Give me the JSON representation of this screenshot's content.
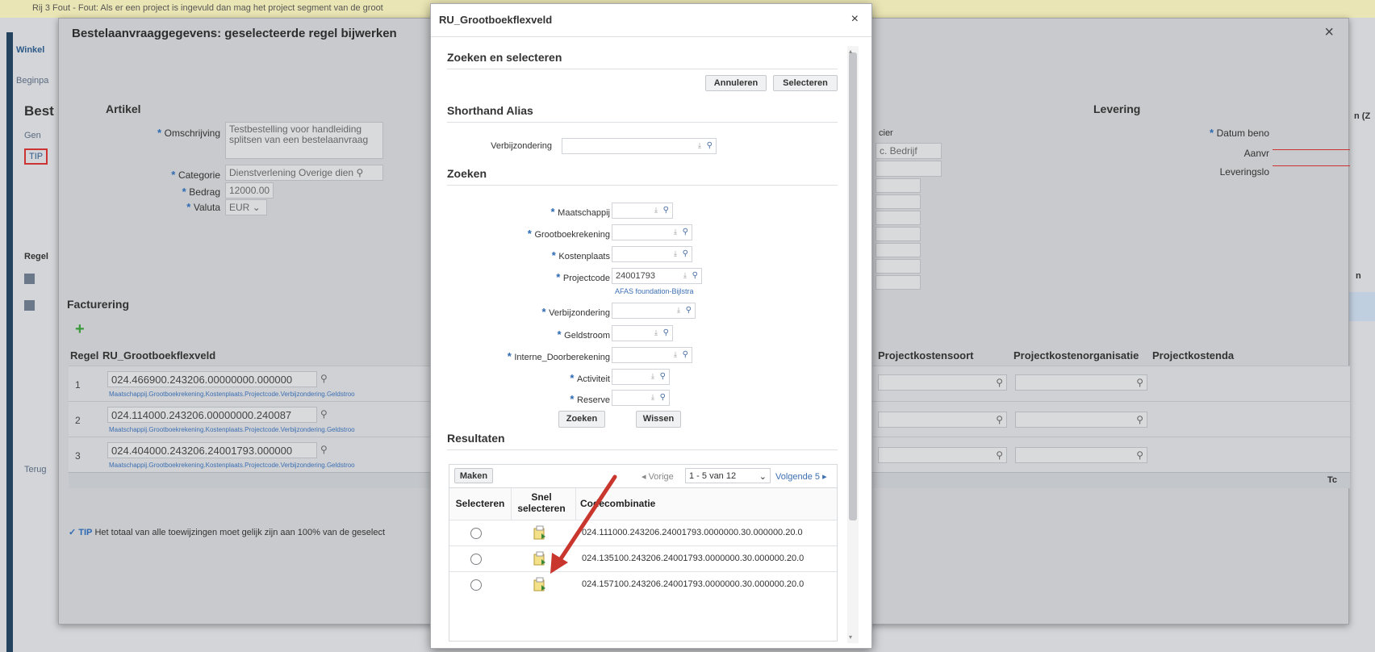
{
  "error_bar": "Rij 3 Fout - Fout: Als er een project is ingevuld dan mag het project segment van de groot",
  "background": {
    "tab": "Winkel",
    "breadcrumb": "Beginpa",
    "title": "Best",
    "gen": "Gen",
    "tip": "TIP",
    "regel": "Regel",
    "terug": "Terug",
    "right_label": "n (Z",
    "right_n": "n",
    "right_t": "Tc"
  },
  "main_dialog": {
    "title": "Bestelaanvraaggegevens: geselecteerde regel bijwerken",
    "close": "×",
    "artikel": {
      "heading": "Artikel",
      "omschrijving_label": "Omschrijving",
      "omschrijving_value": "Testbestelling voor handleiding splitsen van een bestelaanvraag",
      "categorie_label": "Categorie",
      "categorie_value": "Dienstverlening Overige dien",
      "bedrag_label": "Bedrag",
      "bedrag_value": "12000.00",
      "valuta_label": "Valuta",
      "valuta_value": "EUR"
    },
    "levering": {
      "heading": "Levering",
      "datum_label": "Datum beno",
      "aanvr_label": "Aanvr",
      "leveringslo_label": "Leveringslo",
      "cier_label": "cier",
      "bedrijf_value": "c. Bedrijf"
    },
    "facturering": {
      "heading": "Facturering",
      "add_icon": "plus-icon",
      "col_regel": "Regel",
      "col_ru": "RU_Grootboekflexveld",
      "col_projectkostensoort": "Projectkostensoort",
      "col_projectkostenorganisatie": "Projectkostenorganisatie",
      "col_projectkostenda": "Projectkostenda",
      "rows": [
        {
          "num": "1",
          "account": "024.466900.243206.00000000.000000",
          "segments": "Maatschappij.Grootboekrekening.Kostenplaats.Projectcode.Verbijzondering.Geldstroo"
        },
        {
          "num": "2",
          "account": "024.114000.243206.00000000.240087",
          "segments": "Maatschappij.Grootboekrekening.Kostenplaats.Projectcode.Verbijzondering.Geldstroo"
        },
        {
          "num": "3",
          "account": "024.404000.243206.24001793.000000",
          "segments": "Maatschappij.Grootboekrekening.Kostenplaats.Projectcode.Verbijzondering.Geldstroo"
        }
      ]
    },
    "tip_text": "Het totaal van alle toewijzingen moet gelijk zijn aan 100% van de geselect",
    "tip_label": "TIP"
  },
  "ru_dialog": {
    "title": "RU_Grootboekflexveld",
    "close": "×",
    "zoeken_en_selecteren": "Zoeken en selecteren",
    "annuleren": "Annuleren",
    "selecteren": "Selecteren",
    "shorthand_alias": "Shorthand Alias",
    "alias_label": "Verbijzondering",
    "zoeken": "Zoeken",
    "fields": [
      {
        "label": "Maatschappij",
        "value": ""
      },
      {
        "label": "Grootboekrekening",
        "value": ""
      },
      {
        "label": "Kostenplaats",
        "value": ""
      },
      {
        "label": "Projectcode",
        "value": "24001793"
      },
      {
        "label": "Verbijzondering",
        "value": ""
      },
      {
        "label": "Geldstroom",
        "value": ""
      },
      {
        "label": "Interne_Doorberekening",
        "value": ""
      },
      {
        "label": "Activiteit",
        "value": ""
      },
      {
        "label": "Reserve",
        "value": ""
      }
    ],
    "project_desc": "AFAS foundation-Bijlstra",
    "zoeken_btn": "Zoeken",
    "wissen_btn": "Wissen",
    "resultaten": "Resultaten",
    "maken_btn": "Maken",
    "vorige": "Vorige",
    "range": "1 - 5 van 12",
    "volgende": "Volgende 5",
    "col_selecteren": "Selecteren",
    "col_snel": "Snel selecteren",
    "col_code": "Codecombinatie",
    "results": [
      "024.111000.243206.24001793.0000000.30.000000.20.0",
      "024.135100.243206.24001793.0000000.30.000000.20.0",
      "024.157100.243206.24001793.0000000.30.000000.20.0"
    ]
  },
  "colors": {
    "arrow": "#c8362e",
    "required": "#2e6ab3",
    "link": "#3d6fb3"
  }
}
